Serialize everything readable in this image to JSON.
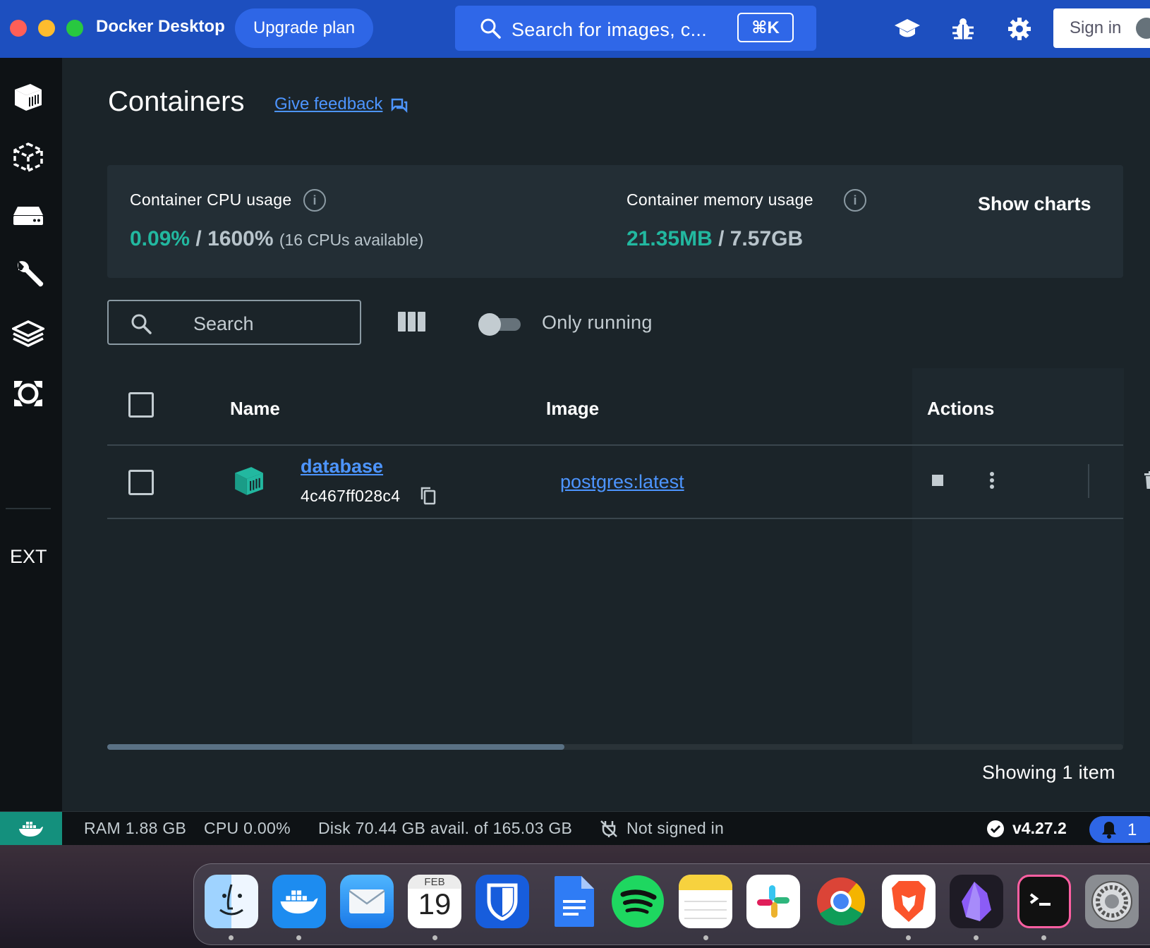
{
  "titlebar": {
    "app_name": "Docker Desktop",
    "upgrade_label": "Upgrade plan",
    "search_placeholder": "Search for images, c...",
    "search_shortcut": "⌘K",
    "sign_in_label": "Sign in"
  },
  "sidebar": {
    "items": [
      {
        "icon": "containers-icon",
        "active": true
      },
      {
        "icon": "images-icon"
      },
      {
        "icon": "volumes-icon"
      },
      {
        "icon": "dev-environments-icon"
      },
      {
        "icon": "builds-icon"
      },
      {
        "icon": "docker-scout-icon"
      }
    ],
    "extensions_label": "EXT"
  },
  "page": {
    "title": "Containers",
    "feedback_link": "Give feedback"
  },
  "stats": {
    "cpu_label": "Container CPU usage",
    "cpu_used": "0.09%",
    "cpu_sep": " / ",
    "cpu_total": "1600%",
    "cpu_note": "(16 CPUs available)",
    "mem_label": "Container memory usage",
    "mem_used": "21.35MB",
    "mem_sep": " / ",
    "mem_total": "7.57GB",
    "show_charts": "Show charts"
  },
  "toolbar": {
    "search_placeholder": "Search",
    "only_running_label": "Only running",
    "only_running_on": false
  },
  "table": {
    "headers": {
      "name": "Name",
      "image": "Image",
      "actions": "Actions"
    },
    "rows": [
      {
        "name": "database",
        "id": "4c467ff028c4",
        "image": "postgres:latest"
      }
    ],
    "footer": "Showing 1 item",
    "scroll_fraction": 0.45
  },
  "statusbar": {
    "ram": "RAM 1.88 GB",
    "cpu": "CPU 0.00%",
    "disk": "Disk 70.44 GB avail. of 165.03 GB",
    "signin_status": "Not signed in",
    "version": "v4.27.2",
    "notifications": "1"
  },
  "dock": {
    "calendar_month": "FEB",
    "calendar_day": "19",
    "apps": [
      "finder-icon",
      "docker-icon",
      "mail-icon",
      "calendar-icon",
      "bitwarden-icon",
      "google-docs-icon",
      "spotify-icon",
      "notes-icon",
      "slack-icon",
      "chrome-icon",
      "brave-icon",
      "obsidian-icon",
      "terminal-icon",
      "system-settings-icon"
    ]
  },
  "colors": {
    "brand_blue": "#1d4fbf",
    "accent_green": "#22b8a0",
    "link_blue": "#4d95ff"
  }
}
